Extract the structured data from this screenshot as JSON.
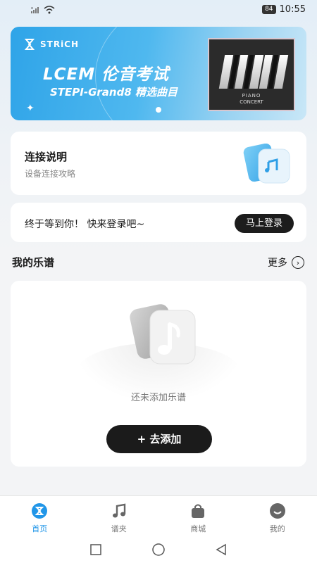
{
  "status": {
    "battery": "84",
    "time": "10:55"
  },
  "banner": {
    "brand": "STRiCH",
    "title_line1": "LCEM 伦音考试",
    "title_line2": "STEPI-Grand8 精选曲目",
    "album_caption1": "PIANO",
    "album_caption2": "CONCERT"
  },
  "connect": {
    "title": "连接说明",
    "subtitle": "设备连接攻略"
  },
  "login": {
    "prompt": "终于等到你！ 快来登录吧~",
    "button": "马上登录"
  },
  "scores": {
    "section_title": "我的乐谱",
    "more_label": "更多",
    "empty_text": "还未添加乐谱",
    "add_button": "+ 去添加"
  },
  "tabs": [
    {
      "label": "首页",
      "icon": "home-logo-icon",
      "active": true
    },
    {
      "label": "谱夹",
      "icon": "music-note-icon",
      "active": false
    },
    {
      "label": "商城",
      "icon": "shopping-bag-icon",
      "active": false
    },
    {
      "label": "我的",
      "icon": "smile-face-icon",
      "active": false
    }
  ],
  "colors": {
    "accent": "#2196e8",
    "dark_button": "#1c1c1c",
    "banner_start": "#2fa4e8"
  }
}
